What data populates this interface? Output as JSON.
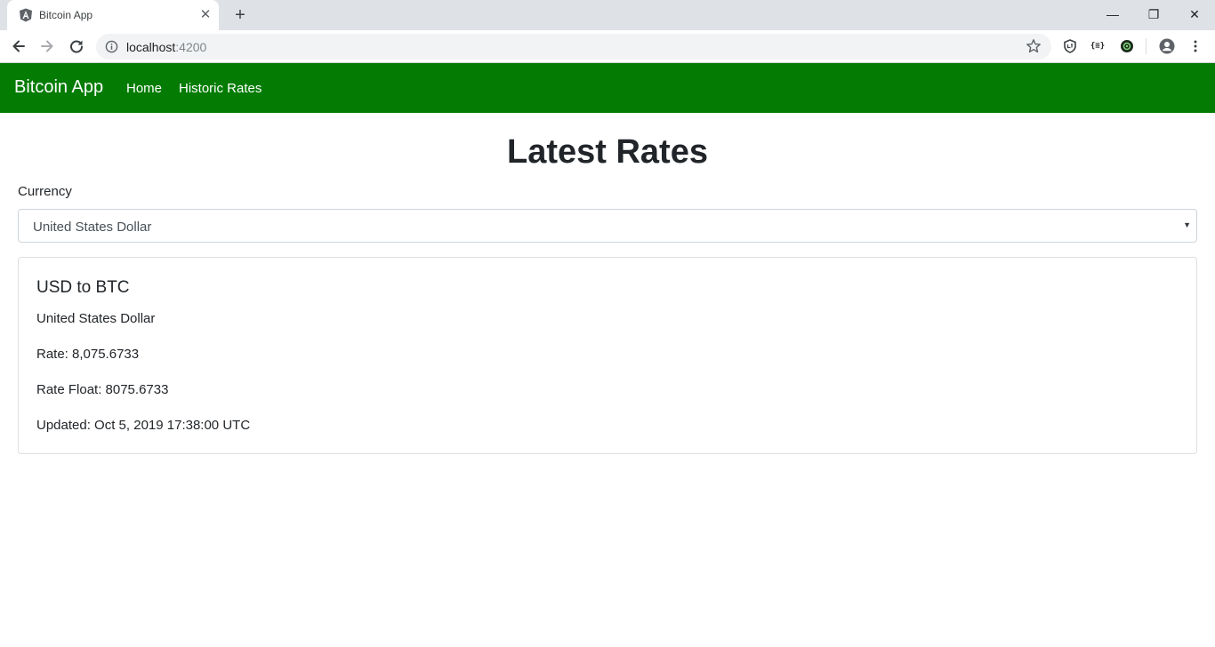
{
  "browser": {
    "tab_title": "Bitcoin App",
    "close_glyph": "✕",
    "new_tab_glyph": "+",
    "url_host": "localhost",
    "url_port": ":4200",
    "extension_label": "{≡}",
    "window_controls": {
      "minimize": "—",
      "maximize": "❐",
      "close": "✕"
    }
  },
  "navbar": {
    "brand": "Bitcoin App",
    "links": [
      "Home",
      "Historic Rates"
    ],
    "background": "#047c04"
  },
  "page": {
    "title": "Latest Rates",
    "currency_label": "Currency",
    "currency_selected": "United States Dollar",
    "caret": "▼"
  },
  "card": {
    "title": "USD to BTC",
    "description": "United States Dollar",
    "rate": "Rate: 8,075.6733",
    "rate_float": "Rate Float: 8075.6733",
    "updated": "Updated: Oct 5, 2019 17:38:00 UTC"
  }
}
